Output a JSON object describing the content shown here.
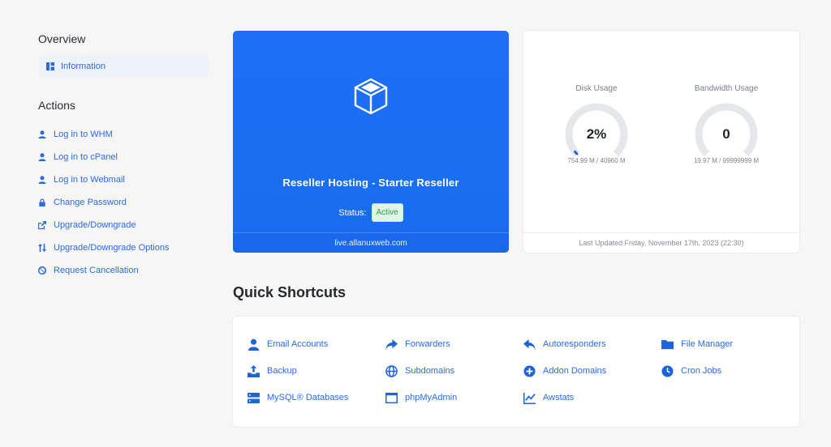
{
  "sidebar": {
    "overview_title": "Overview",
    "overview_item": "Information",
    "actions_title": "Actions",
    "actions": [
      {
        "label": "Log in to WHM",
        "icon": "user-icon"
      },
      {
        "label": "Log in to cPanel",
        "icon": "user-icon"
      },
      {
        "label": "Log in to Webmail",
        "icon": "user-icon"
      },
      {
        "label": "Change Password",
        "icon": "lock-icon"
      },
      {
        "label": "Upgrade/Downgrade",
        "icon": "external-link-icon"
      },
      {
        "label": "Upgrade/Downgrade Options",
        "icon": "sort-arrows-icon"
      },
      {
        "label": "Request Cancellation",
        "icon": "ban-icon"
      }
    ]
  },
  "product": {
    "name": "Reseller Hosting - Starter Reseller",
    "status_label": "Status:",
    "status": "Active",
    "domain": "live.allanuxweb.com"
  },
  "usage": {
    "disk": {
      "title": "Disk Usage",
      "value": "2%",
      "detail": "754.99 M / 40960 M",
      "fraction": 0.02
    },
    "bandwidth": {
      "title": "Bandwidth Usage",
      "value": "0",
      "detail": "19.97 M / 99999999 M",
      "fraction": 0
    },
    "last_updated": "Last Updated Friday, November 17th, 2023 (22:30)"
  },
  "quick_shortcuts": {
    "title": "Quick Shortcuts",
    "items": [
      {
        "label": "Email Accounts",
        "icon": "user-icon"
      },
      {
        "label": "Forwarders",
        "icon": "share-arrow-icon"
      },
      {
        "label": "Autoresponders",
        "icon": "reply-icon"
      },
      {
        "label": "File Manager",
        "icon": "folder-icon"
      },
      {
        "label": "Backup",
        "icon": "upload-tray-icon"
      },
      {
        "label": "Subdomains",
        "icon": "globe-icon"
      },
      {
        "label": "Addon Domains",
        "icon": "plus-circle-icon"
      },
      {
        "label": "Cron Jobs",
        "icon": "clock-icon"
      },
      {
        "label": "MySQL® Databases",
        "icon": "server-icon"
      },
      {
        "label": "phpMyAdmin",
        "icon": "window-icon"
      },
      {
        "label": "Awstats",
        "icon": "line-chart-icon"
      }
    ]
  },
  "colors": {
    "accent": "#2a6be0",
    "card_blue": "#1e6ff5",
    "active_green": "#2e9d4d"
  }
}
